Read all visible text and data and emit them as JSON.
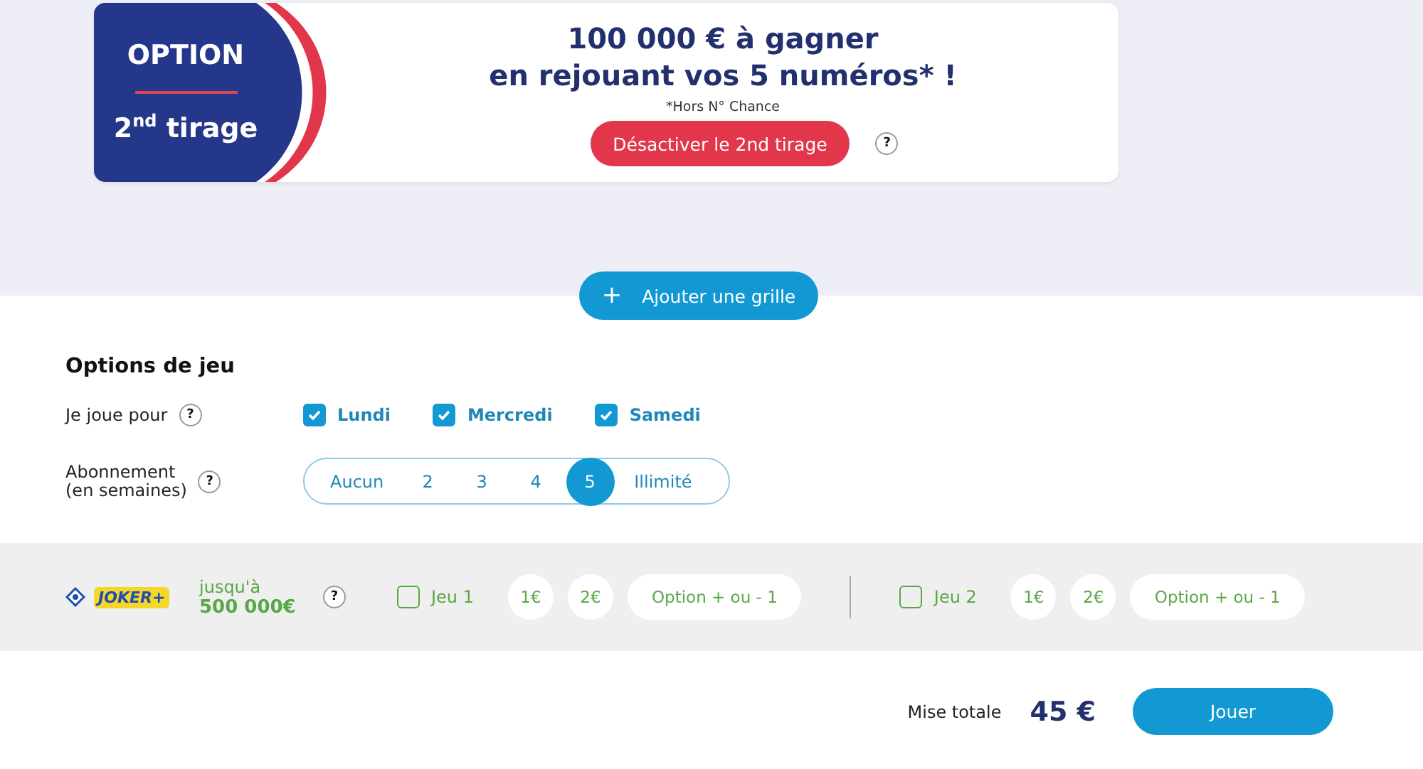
{
  "option_card": {
    "badge_title": "OPTION",
    "badge_subtitle": "2$^{nd}$ tirage",
    "headline_1": "100 000 € à gagner",
    "headline_2": "en rejouant vos 5 numéros* !",
    "footnote": "*Hors N° Chance",
    "button": "Désactiver le 2nd tirage",
    "help": "?"
  },
  "add_grid_button": {
    "icon": "+",
    "label": "Ajouter une grille"
  },
  "options": {
    "title": "Options de jeu",
    "days": {
      "label": "Je joue pour",
      "help": "?",
      "items": [
        {
          "label": "Lundi",
          "checked": true
        },
        {
          "label": "Mercredi",
          "checked": true
        },
        {
          "label": "Samedi",
          "checked": true
        }
      ]
    },
    "subscription": {
      "label_1": "Abonnement",
      "label_2": "(en semaines)",
      "help": "?",
      "items": [
        {
          "label": "Aucun",
          "selected": false
        },
        {
          "label": "2",
          "selected": false
        },
        {
          "label": "3",
          "selected": false
        },
        {
          "label": "4",
          "selected": false
        },
        {
          "label": "5",
          "selected": true
        },
        {
          "label": "Illimité",
          "selected": false
        }
      ]
    }
  },
  "joker": {
    "logo": "JOKER+",
    "prize_1": "jusqu'à",
    "prize_2": "500 000€",
    "help": "?",
    "games": [
      {
        "label": "Jeu 1",
        "checked": false,
        "stakes": [
          "1€",
          "2€"
        ],
        "option": "Option + ou - 1"
      },
      {
        "label": "Jeu 2",
        "checked": false,
        "stakes": [
          "1€",
          "2€"
        ],
        "option": "Option + ou - 1"
      }
    ]
  },
  "footer": {
    "total_label": "Mise totale",
    "total": "45 €",
    "play_button": "Jouer"
  }
}
